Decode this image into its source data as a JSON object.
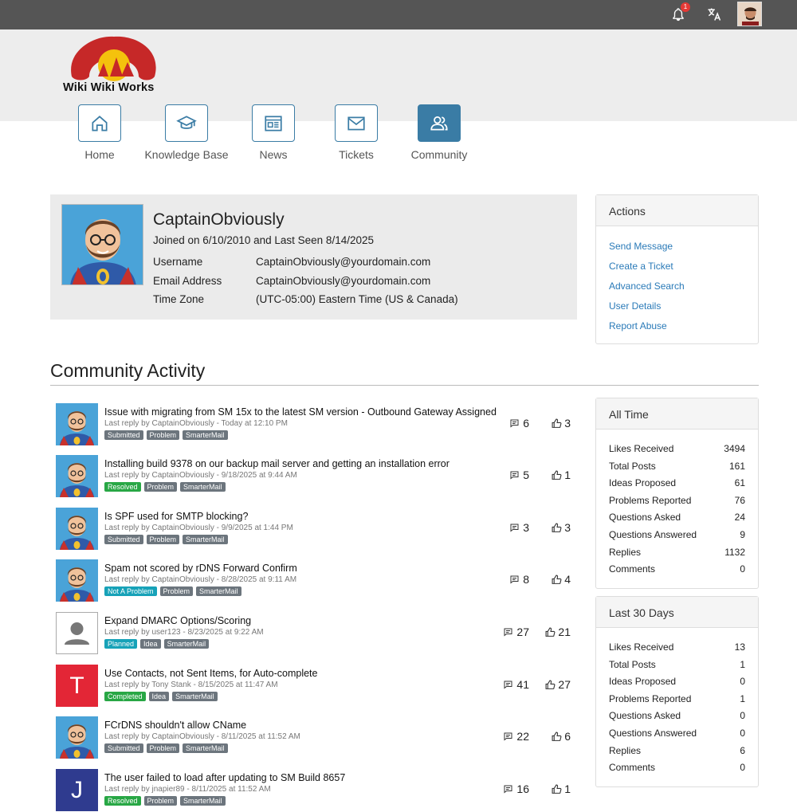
{
  "topbar": {
    "notification_count": "1"
  },
  "brand": {
    "logo_text": "Wiki Wiki Works"
  },
  "nav": [
    {
      "label": "Home"
    },
    {
      "label": "Knowledge Base"
    },
    {
      "label": "News"
    },
    {
      "label": "Tickets"
    },
    {
      "label": "Community"
    }
  ],
  "profile": {
    "name": "CaptainObviously",
    "joined": "Joined on 6/10/2010 and Last Seen 8/14/2025",
    "fields": [
      {
        "label": "Username",
        "value": "CaptainObviously@yourdomain.com"
      },
      {
        "label": "Email Address",
        "value": "CaptainObviously@yourdomain.com"
      },
      {
        "label": "Time Zone",
        "value": "(UTC-05:00) Eastern Time (US & Canada)"
      }
    ]
  },
  "actions": {
    "title": "Actions",
    "items": [
      "Send Message",
      "Create a Ticket",
      "Advanced Search",
      "User Details",
      "Report Abuse"
    ]
  },
  "activity": {
    "title": "Community Activity",
    "rows": [
      {
        "title": "Issue with migrating from SM 15x to the latest SM version - Outbound Gateway Assigned",
        "meta": "Last reply by CaptainObviously - Today at 12:10 PM",
        "tags": [
          "Submitted",
          "Problem",
          "SmarterMail"
        ],
        "comments": "6",
        "likes": "3"
      },
      {
        "title": "Installing build 9378 on our backup mail server and getting an installation error",
        "meta": "Last reply by CaptainObviously - 9/18/2025 at 9:44 AM",
        "tags": [
          "Resolved",
          "Problem",
          "SmarterMail"
        ],
        "comments": "5",
        "likes": "1"
      },
      {
        "title": "Is SPF used for SMTP blocking?",
        "meta": "Last reply by CaptainObviously - 9/9/2025 at 1:44 PM",
        "tags": [
          "Submitted",
          "Problem",
          "SmarterMail"
        ],
        "comments": "3",
        "likes": "3"
      },
      {
        "title": "Spam not scored by rDNS Forward Confirm",
        "meta": "Last reply by CaptainObviously - 8/28/2025 at 9:11 AM",
        "tags": [
          "Not A Problem",
          "Problem",
          "SmarterMail"
        ],
        "comments": "8",
        "likes": "4"
      },
      {
        "title": "Expand DMARC Options/Scoring",
        "meta": "Last reply by user123 - 8/23/2025 at 9:22 AM",
        "tags": [
          "Planned",
          "Idea",
          "SmarterMail"
        ],
        "comments": "27",
        "likes": "21"
      },
      {
        "title": "Use Contacts, not Sent Items, for Auto-complete",
        "meta": "Last reply by Tony Stank - 8/15/2025 at 11:47 AM",
        "tags": [
          "Completed",
          "Idea",
          "SmarterMail"
        ],
        "comments": "41",
        "likes": "27",
        "initial": "T"
      },
      {
        "title": "FCrDNS shouldn't allow CName",
        "meta": "Last reply by CaptainObviously - 8/11/2025 at 11:52 AM",
        "tags": [
          "Submitted",
          "Problem",
          "SmarterMail"
        ],
        "comments": "22",
        "likes": "6"
      },
      {
        "title": "The user failed to load after updating to SM Build 8657",
        "meta": "Last reply by jnapier89 - 8/11/2025 at 11:52 AM",
        "tags": [
          "Resolved",
          "Problem",
          "SmarterMail"
        ],
        "comments": "16",
        "likes": "1",
        "initial": "J"
      }
    ]
  },
  "all_time": {
    "title": "All Time",
    "stats": [
      {
        "label": "Likes Received",
        "value": "3494"
      },
      {
        "label": "Total Posts",
        "value": "161"
      },
      {
        "label": "Ideas Proposed",
        "value": "61"
      },
      {
        "label": "Problems Reported",
        "value": "76"
      },
      {
        "label": "Questions Asked",
        "value": "24"
      },
      {
        "label": "Questions Answered",
        "value": "9"
      },
      {
        "label": "Replies",
        "value": "1132"
      },
      {
        "label": "Comments",
        "value": "0"
      }
    ]
  },
  "last_30": {
    "title": "Last 30 Days",
    "stats": [
      {
        "label": "Likes Received",
        "value": "13"
      },
      {
        "label": "Total Posts",
        "value": "1"
      },
      {
        "label": "Ideas Proposed",
        "value": "0"
      },
      {
        "label": "Problems Reported",
        "value": "1"
      },
      {
        "label": "Questions Asked",
        "value": "0"
      },
      {
        "label": "Questions Answered",
        "value": "0"
      },
      {
        "label": "Replies",
        "value": "6"
      },
      {
        "label": "Comments",
        "value": "0"
      }
    ]
  },
  "colors": {
    "accent": "#3a7ca5",
    "link": "#2a7ab8",
    "resolved": "#28a745",
    "not_a_problem": "#17a2b8"
  }
}
